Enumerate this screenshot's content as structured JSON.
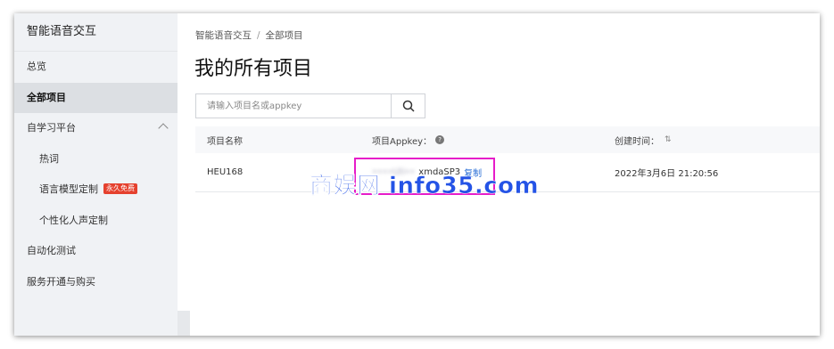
{
  "sidebar": {
    "brand": "智能语音交互",
    "items": [
      {
        "label": "总览"
      },
      {
        "label": "全部项目"
      },
      {
        "label": "自学习平台"
      },
      {
        "label": "热词"
      },
      {
        "label": "语言模型定制",
        "badge": "永久免费"
      },
      {
        "label": "个性化人声定制"
      },
      {
        "label": "自动化测试"
      },
      {
        "label": "服务开通与购买"
      }
    ]
  },
  "breadcrumb": {
    "root": "智能语音交互",
    "separator": "/",
    "current": "全部项目"
  },
  "page_title": "我的所有项目",
  "search": {
    "placeholder": "请输入项目名或appkey",
    "value": ""
  },
  "table": {
    "headers": {
      "name": "项目名称",
      "appkey": "项目Appkey：",
      "created": "创建时间："
    },
    "rows": [
      {
        "name": "HEU168",
        "appkey_masked": "••••Uli••",
        "appkey_visible": "xmdaSP3",
        "copy": "复制",
        "created": "2022年3月6日 21:20:56"
      }
    ]
  },
  "watermark": "商娱网 info35.com",
  "colors": {
    "highlight": "#e61cc9",
    "watermark": "#2453e6",
    "badge": "#e5412e",
    "link": "#2b6fd6"
  },
  "icons": [
    "search-icon",
    "chevron-up-icon",
    "help-icon",
    "sort-icon"
  ]
}
